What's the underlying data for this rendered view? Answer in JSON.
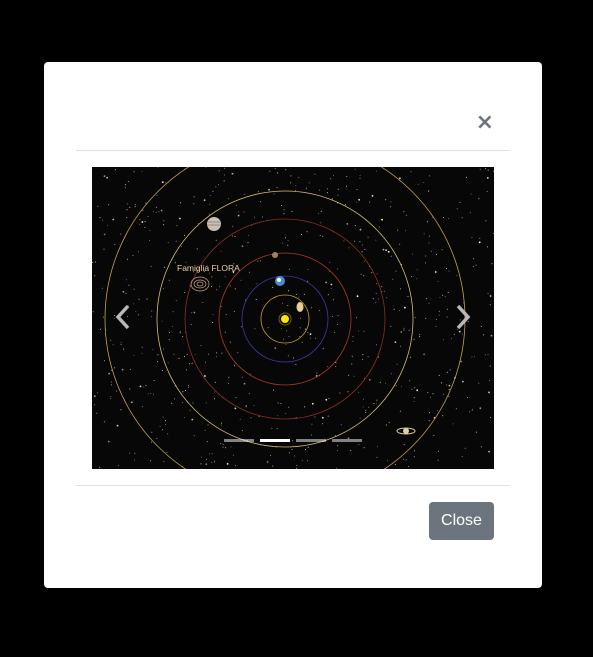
{
  "modal": {
    "close_symbol": "×",
    "close_button_label": "Close"
  },
  "carousel": {
    "slide_label": "Famiglia FLORA",
    "prev_icon": "chevron-left-icon",
    "next_icon": "chevron-right-icon",
    "slide_count": 4,
    "active_slide": 2
  },
  "colors": {
    "secondary_button": "#6c757d",
    "divider": "#dee2e6",
    "backdrop": "#000000"
  }
}
